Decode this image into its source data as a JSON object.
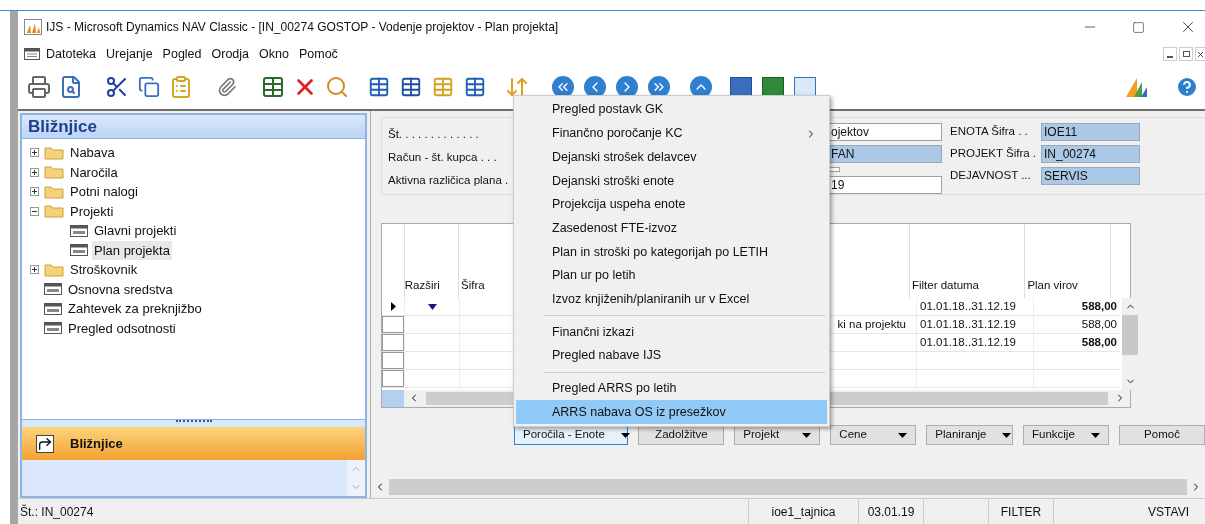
{
  "window": {
    "title": "IJS - Microsoft Dynamics NAV Classic - [IN_00274 GOSTOP - Vodenje projektov - Plan projekta]"
  },
  "menu_bar": [
    "Datoteka",
    "Urejanje",
    "Pogled",
    "Orodja",
    "Okno",
    "Pomoč"
  ],
  "sidebar": {
    "title": "Bližnjice",
    "tree": [
      {
        "label": "Nabava",
        "kind": "folder",
        "expanded": false,
        "selected": false
      },
      {
        "label": "Naročila",
        "kind": "folder",
        "expanded": false,
        "selected": false
      },
      {
        "label": "Potni nalogi",
        "kind": "folder",
        "expanded": false,
        "selected": false
      },
      {
        "label": "Projekti",
        "kind": "folder",
        "expanded": true,
        "selected": false,
        "children": [
          {
            "label": "Glavni projekti",
            "kind": "form",
            "selected": false
          },
          {
            "label": "Plan projekta",
            "kind": "form",
            "selected": true
          }
        ]
      },
      {
        "label": "Stroškovnik",
        "kind": "folder",
        "expanded": false,
        "selected": false
      },
      {
        "label": "Osnovna sredstva",
        "kind": "form",
        "selected": false
      },
      {
        "label": "Zahtevek za preknjižbo",
        "kind": "form",
        "selected": false
      },
      {
        "label": "Pregled odsotnosti",
        "kind": "form",
        "selected": false
      }
    ],
    "footer_button": "Bližnjice"
  },
  "form": {
    "left_labels": [
      "Št. . . . . . . . . . . . .",
      "Račun - št. kupca . . .",
      "Aktivna različica plana ."
    ],
    "middle_fields": [
      {
        "value": "ojektov",
        "highlighted": false
      },
      {
        "value": "FAN",
        "highlighted": true
      },
      {
        "highlighted": false,
        "kind": "small"
      },
      {
        "value": "19",
        "highlighted": false
      }
    ],
    "right_fields": [
      {
        "label": "ENOTA Šifra . .",
        "value": "IOE11"
      },
      {
        "label": "PROJEKT Šifra .",
        "value": "IN_00274"
      },
      {
        "label": "DEJAVNOST ...",
        "value": "SERVIS"
      }
    ]
  },
  "table": {
    "columns": [
      "Razširi",
      "Šifra",
      "Filter datuma",
      "Plan virov"
    ],
    "rows": [
      {
        "current": true,
        "expand_marker": true,
        "filter": "01.01.18..31.12.19",
        "plan": "588,00",
        "bold": true
      },
      {
        "current": false,
        "expand_marker": false,
        "column_3": "ki na projektu",
        "filter": "01.01.18..31.12.19",
        "plan": "588,00",
        "bold": false
      },
      {
        "current": false,
        "expand_marker": false,
        "filter": "01.01.18..31.12.19",
        "plan": "588,00",
        "bold": true
      },
      {
        "current": false,
        "expand_marker": false
      },
      {
        "current": false,
        "expand_marker": false
      }
    ]
  },
  "buttons": [
    {
      "label": "Poročila - Enote",
      "dropdown": true,
      "focused": true
    },
    {
      "label": "Zadolžitve",
      "dropdown": false,
      "focused": false
    },
    {
      "label": "Projekt",
      "dropdown": true,
      "focused": false
    },
    {
      "label": "Cene",
      "dropdown": true,
      "focused": false
    },
    {
      "label": "Planiranje",
      "dropdown": true,
      "focused": false
    },
    {
      "label": "Funkcije",
      "dropdown": true,
      "focused": false
    },
    {
      "label": "Pomoč",
      "dropdown": false,
      "focused": false
    }
  ],
  "dropdown_menu": [
    {
      "kind": "item",
      "label": "Pregled postavk GK",
      "submenu": false,
      "selected": false
    },
    {
      "kind": "item",
      "label": "Finančno poročanje KC",
      "submenu": true,
      "selected": false
    },
    {
      "kind": "item",
      "label": "Dejanski strošek delavcev",
      "submenu": false,
      "selected": false
    },
    {
      "kind": "item",
      "label": "Dejanski stroški enote",
      "submenu": false,
      "selected": false
    },
    {
      "kind": "item",
      "label": "Projekcija uspeha enote",
      "submenu": false,
      "selected": false
    },
    {
      "kind": "item",
      "label": "Zasedenost FTE-izvoz",
      "submenu": false,
      "selected": false
    },
    {
      "kind": "item",
      "label": "Plan in stroški po kategorijah po LETIH",
      "submenu": false,
      "selected": false
    },
    {
      "kind": "item",
      "label": "Plan ur po letih",
      "submenu": false,
      "selected": false
    },
    {
      "kind": "item",
      "label": "Izvoz knjiženih/planiranih ur v Excel",
      "submenu": false,
      "selected": false
    },
    {
      "kind": "separator"
    },
    {
      "kind": "item",
      "label": "Finančni izkazi",
      "submenu": false,
      "selected": false
    },
    {
      "kind": "item",
      "label": "Pregled nabave IJS",
      "submenu": false,
      "selected": false
    },
    {
      "kind": "separator"
    },
    {
      "kind": "item",
      "label": "Pregled ARRS po letih",
      "submenu": false,
      "selected": false
    },
    {
      "kind": "item",
      "label": "ARRS nabava OS iz presežkov",
      "submenu": false,
      "selected": true
    }
  ],
  "status_bar": [
    "Št.: IN_00274",
    "ioe1_tajnica",
    "03.01.19",
    "FILTER",
    "VSTAVI"
  ]
}
